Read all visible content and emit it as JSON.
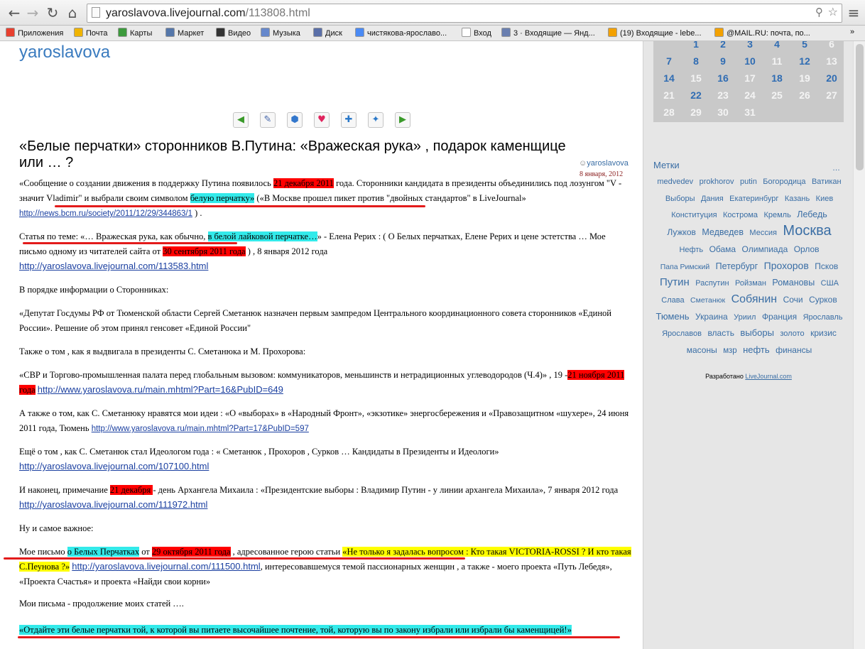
{
  "browser": {
    "url_host": "yaroslavova.livejournal.com",
    "url_path": "/113808.html",
    "bookmarks": [
      {
        "label": "Приложения",
        "color": "#e8402f"
      },
      {
        "label": "Почта",
        "color": "#f0b400"
      },
      {
        "label": "Карты",
        "color": "#3c9a3c"
      },
      {
        "label": "Маркет",
        "color": "#5577aa"
      },
      {
        "label": "Видео",
        "color": "#333333"
      },
      {
        "label": "Музыка",
        "color": "#6688cc"
      },
      {
        "label": "Диск",
        "color": "#5a6fa8"
      },
      {
        "label": "чистякова-ярославо...",
        "color": "#4a8af4"
      },
      {
        "label": "Вход",
        "color": "#ffffff"
      },
      {
        "label": "3 · Входящие — Янд...",
        "color": "#6a7fb0"
      },
      {
        "label": "(19) Входящие - lebe...",
        "color": "#f3a100"
      },
      {
        "label": "@MAIL.RU: почта, по...",
        "color": "#f3a100"
      }
    ],
    "more": "»"
  },
  "blog": {
    "name": "yaroslavova"
  },
  "post": {
    "title": "«Белые перчатки» сторонников В.Путина: «Вражеская рука» , подарок каменщице или … ?",
    "author": "yaroslavova",
    "date": "8 января, 2012",
    "p1_a": "«Сообщение о создании движения в поддержку Путина появилось ",
    "p1_h1": "21 декабря 2011",
    "p1_b": " года. Сторонники кандидата в президенты объединились под лозунгом \"V - значит Vladimir\" и выбрали своим символом ",
    "p1_h2": "белую перчатку»",
    "p1_c": " («В Москве прошел пикет против \"двойных стандартов\" в LiveJournal» ",
    "p1_link": "http://news.bcm.ru/society/2011/12/29/344863/1",
    "p1_d": " ) .",
    "p2_a": "Статья  по теме:   «… Вражеская рука, как обычно, ",
    "p2_h1": "в белой лайковой перчатке…",
    "p2_b": "» - Елена Рерих :   ( О Белых перчатках, Елене Рерих и цене эстетства … Мое письмо одному из читателей сайта от ",
    "p2_h2": "30 сентября 2011 года",
    "p2_c": " ) ,  8  января 2012 года",
    "p2_link": "http://yaroslavova.livejournal.com/113583.html",
    "p3": "В порядке информации о Сторонниках:",
    "p4": " «Депутат Госдумы РФ от Тюменской области Сергей Сметанюк назначен первым зампредом Центрального координационного совета сторонников «Единой России». Решение об этом принял генсовет «Единой России\"",
    "p5": " Также  о том , как я   выдвигала в президенты  С. Сметанюка и  М. Прохорова:",
    "p6_a": "«СВР и Торгово-промышленная палата перед глобальным вызовом: коммуникаторов, меньшинств и нетрадиционных углеводородов (Ч.4)»  , 19 -",
    "p6_h1": "21 ноября  2011  года",
    "p6_b": "   ",
    "p6_link": "http://www.yaroslavova.ru/main.mhtml?Part=16&PubID=649",
    "p7_a": " А также  о  том, как  С. Сметанюку  нравятся мои идеи :  «О «выборах» в «Народный Фронт», «экзотике» энергосбережения и «Правозащитном «шухере»,   24 июня 2011 года, Тюмень ",
    "p7_link": "http://www.yaroslavova.ru/main.mhtml?Part=17&PubID=597",
    "p8_a": "Ещё о    том , как С. Сметанюк  стал Идеологом года :  « Сметанюк , Прохоров , Сурков … Кандидаты в Президенты и Идеологи»",
    "p8_link": "http://yaroslavova.livejournal.com/107100.html",
    "p9_a": " И наконец,  примечание ",
    "p9_h1": "21  декабря ",
    "p9_b": "    - день  Архангела  Михаила :   «Президентские выборы : Владимир Путин - у линии архангела Михаила», 7 января 2012  года  ",
    "p9_link": "http://yaroslavova.livejournal.com/111972.html",
    "p10": " Ну и самое  важное:",
    "p11_a": "Мое  письмо   ",
    "p11_h1": "о Белых Перчатках",
    "p11_b": "   от ",
    "p11_h2": "29 октября   2011  года",
    "p11_c": "    , адресованное    герою      статьи    ",
    "p11_h3": "«Не только я задалась вопросом : Кто такая VICTORIA-ROSSI ? И кто такая С.Пеунова ?»",
    "p11_d": " ",
    "p11_link": "http://yaroslavova.livejournal.com/111500.html",
    "p11_e": ",   интересовавшемуся темой  пассионарных женщин  ,    а также -          моего  проекта «Путь Лебедя»,    «Проекта Счастья» и     проекта  «Найди свои корни»",
    "p12": "Мои письма  - продолжение   моих статей ….",
    "p13_h1": "«Отдайте эти белые перчатки той, к которой вы питаете высочайшее почтение, той, которую вы по закону избрали или избрали бы каменщицей!»"
  },
  "calendar": {
    "rows": [
      [
        "",
        "1",
        "2",
        "3",
        "4",
        "5",
        "6"
      ],
      [
        "7",
        "8",
        "9",
        "10",
        "11",
        "12",
        "13"
      ],
      [
        "14",
        "15",
        "16",
        "17",
        "18",
        "19",
        "20"
      ],
      [
        "21",
        "22",
        "23",
        "24",
        "25",
        "26",
        "27"
      ],
      [
        "28",
        "29",
        "30",
        "31",
        "",
        "",
        ""
      ]
    ],
    "linked": [
      "1",
      "2",
      "3",
      "4",
      "5",
      "7",
      "8",
      "9",
      "10",
      "12",
      "14",
      "16",
      "18",
      "20",
      "22"
    ]
  },
  "sidebar": {
    "tags_heading": "Метки",
    "tags_more": "…",
    "tags": [
      {
        "t": "medvedev",
        "s": 11
      },
      {
        "t": "prokhorov",
        "s": 11
      },
      {
        "t": "putin",
        "s": 11
      },
      {
        "t": "Богородица",
        "s": 11
      },
      {
        "t": "Ватикан",
        "s": 11
      },
      {
        "t": "Выборы",
        "s": 11
      },
      {
        "t": "Дания",
        "s": 11
      },
      {
        "t": "Екатеринбург",
        "s": 11
      },
      {
        "t": "Казань",
        "s": 11
      },
      {
        "t": "Киев",
        "s": 11
      },
      {
        "t": "Конституция",
        "s": 11
      },
      {
        "t": "Кострома",
        "s": 11
      },
      {
        "t": "Кремль",
        "s": 11
      },
      {
        "t": "Лебедь",
        "s": 12.5
      },
      {
        "t": "Лужков",
        "s": 12
      },
      {
        "t": "Медведев",
        "s": 12.5
      },
      {
        "t": "Мессия",
        "s": 11
      },
      {
        "t": "Москва",
        "s": 20
      },
      {
        "t": "Нефть",
        "s": 11
      },
      {
        "t": "Обама",
        "s": 12
      },
      {
        "t": "Олимпиада",
        "s": 12
      },
      {
        "t": "Орлов",
        "s": 12
      },
      {
        "t": "Папа Римский",
        "s": 10.5
      },
      {
        "t": "Петербург",
        "s": 12.5
      },
      {
        "t": "Прохоров",
        "s": 14
      },
      {
        "t": "Псков",
        "s": 12
      },
      {
        "t": "Путин",
        "s": 15
      },
      {
        "t": "Распутин",
        "s": 11
      },
      {
        "t": "Ройзман",
        "s": 11
      },
      {
        "t": "Романовы",
        "s": 12.5
      },
      {
        "t": "США",
        "s": 11
      },
      {
        "t": "Слава",
        "s": 11
      },
      {
        "t": "Сметанюк",
        "s": 10.5
      },
      {
        "t": "Собянин",
        "s": 16
      },
      {
        "t": "Сочи",
        "s": 12
      },
      {
        "t": "Сурков",
        "s": 12
      },
      {
        "t": "Тюмень",
        "s": 13
      },
      {
        "t": "Украина",
        "s": 12
      },
      {
        "t": "Уриил",
        "s": 11
      },
      {
        "t": "Франция",
        "s": 12
      },
      {
        "t": "Ярославль",
        "s": 11
      },
      {
        "t": "Ярославов",
        "s": 11
      },
      {
        "t": "власть",
        "s": 12
      },
      {
        "t": "выборы",
        "s": 13
      },
      {
        "t": "золото",
        "s": 11
      },
      {
        "t": "кризис",
        "s": 12
      },
      {
        "t": "масоны",
        "s": 12
      },
      {
        "t": "мзр",
        "s": 11.5
      },
      {
        "t": "нефть",
        "s": 13
      },
      {
        "t": "финансы",
        "s": 12
      }
    ],
    "powered_label": "Разработано ",
    "powered_link": "LiveJournal.com"
  }
}
